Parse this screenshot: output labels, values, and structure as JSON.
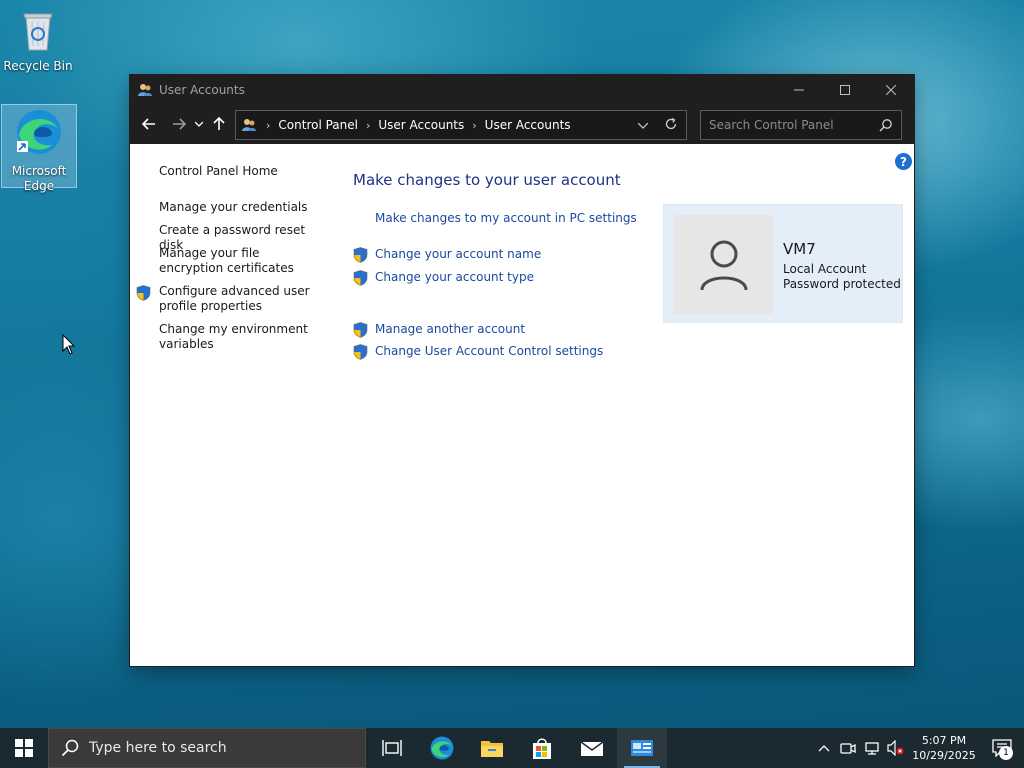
{
  "desktop": {
    "icons": [
      {
        "label": "Recycle Bin",
        "icon": "recycle-bin-icon"
      },
      {
        "label": "Microsoft Edge",
        "icon": "edge-icon",
        "selected": true
      }
    ]
  },
  "window": {
    "title": "User Accounts",
    "controls": [
      "minimize",
      "maximize",
      "close"
    ],
    "address": {
      "crumbs": [
        "Control Panel",
        "User Accounts",
        "User Accounts"
      ]
    },
    "search": {
      "placeholder": "Search Control Panel"
    },
    "help_label": "?",
    "left_nav": [
      {
        "label": "Control Panel Home",
        "shield": false
      },
      {
        "label": "Manage your credentials",
        "shield": false
      },
      {
        "label": "Create a password reset disk",
        "shield": false
      },
      {
        "label": "Manage your file encryption certificates",
        "shield": false
      },
      {
        "label": "Configure advanced user profile properties",
        "shield": true
      },
      {
        "label": "Change my environment variables",
        "shield": false
      }
    ],
    "main": {
      "heading": "Make changes to your user account",
      "links": [
        {
          "label": "Make changes to my account in PC settings",
          "shield": false
        },
        {
          "label": "Change your account name",
          "shield": true
        },
        {
          "label": "Change your account type",
          "shield": true
        },
        {
          "label": "Manage another account",
          "shield": true
        },
        {
          "label": "Change User Account Control settings",
          "shield": true
        }
      ]
    },
    "account": {
      "name": "VM7",
      "type": "Local Account",
      "status": "Password protected"
    }
  },
  "taskbar": {
    "search_placeholder": "Type here to search",
    "apps": [
      "task-view",
      "edge",
      "file-explorer",
      "microsoft-store",
      "mail",
      "control-panel"
    ],
    "active_app": "control-panel",
    "clock": {
      "time": "5:07 PM",
      "date": "10/29/2025"
    },
    "notification_count": "1"
  },
  "colors": {
    "titlebar": "#1f1f1f",
    "heading": "#1e3287",
    "link": "#1a4aa0",
    "panel": "#e4eef9",
    "taskbar": "#1b2a30"
  }
}
